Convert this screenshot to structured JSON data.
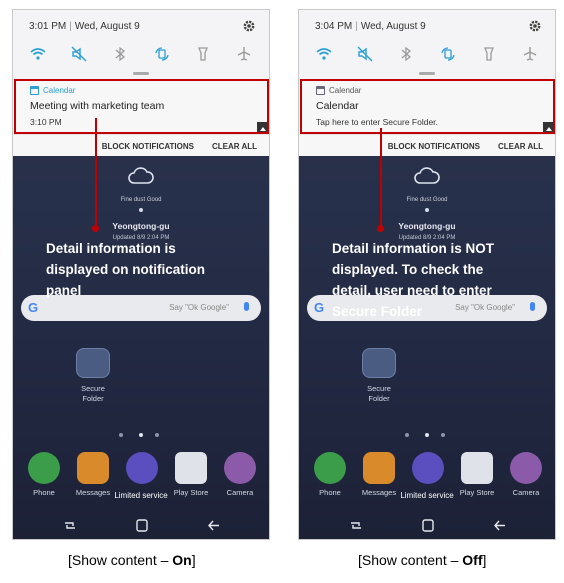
{
  "screens": [
    {
      "status": {
        "time": "3:01 PM",
        "date": "Wed, August 9"
      },
      "notification": {
        "app": "Calendar",
        "title": "Meeting with marketing team",
        "subtitle": "3:10 PM"
      },
      "actions": {
        "block": "BLOCK NOTIFICATIONS",
        "clear": "CLEAR ALL"
      },
      "weather": {
        "dust": "Fine dust Good",
        "city": "Yeongtong-gu",
        "updated": "Updated 8/9 2:04 PM"
      },
      "annotation": "Detail information is displayed on notification panel",
      "annotation_lines": [
        "Detail information is",
        "displayed on notification",
        "panel"
      ],
      "caption_prefix": "[Show content – ",
      "caption_value": "On",
      "caption_suffix": "]"
    },
    {
      "status": {
        "time": "3:04 PM",
        "date": "Wed, August 9"
      },
      "notification": {
        "app": "Calendar",
        "title": "Calendar",
        "subtitle": "Tap here to enter Secure Folder."
      },
      "actions": {
        "block": "BLOCK NOTIFICATIONS",
        "clear": "CLEAR ALL"
      },
      "weather": {
        "dust": "Fine dust Good",
        "city": "Yeongtong-gu",
        "updated": "Updated 8/9 2:04 PM"
      },
      "annotation": "Detail information is NOT displayed. To check the detail, user need to enter Secure Folder",
      "annotation_lines": [
        "Detail information is NOT",
        "displayed. To check the",
        "detail, user need to enter",
        "Secure Folder"
      ],
      "caption_prefix": "[Show content – ",
      "caption_value": "Off",
      "caption_suffix": "]"
    }
  ],
  "home": {
    "search_placeholder": "Say \"Ok Google\"",
    "folder_label_1": "Secure",
    "folder_label_2": "Folder",
    "dock": [
      "Phone",
      "Messages",
      "Internet",
      "Play Store",
      "Camera"
    ],
    "limited_service": "Limited service"
  },
  "colors": {
    "highlight": "#c00000",
    "accent": "#2a9fd6",
    "wallpaper": "#262d45"
  },
  "icons": [
    "wifi-icon",
    "mute-icon",
    "bluetooth-icon",
    "rotate-icon",
    "flashlight-icon",
    "airplane-icon",
    "gear-icon",
    "calendar-icon",
    "cloud-icon",
    "google-icon",
    "mic-icon",
    "secure-folder-icon",
    "phone-icon",
    "messages-icon",
    "internet-icon",
    "play-store-icon",
    "camera-icon",
    "recent-apps-icon",
    "home-icon",
    "back-icon"
  ]
}
